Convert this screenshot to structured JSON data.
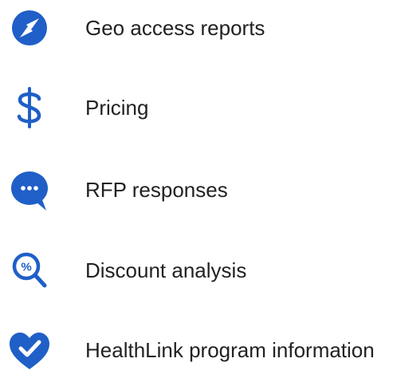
{
  "icon_color": "#1f5fc7",
  "items": [
    {
      "icon": "compass-icon",
      "label": "Geo access reports"
    },
    {
      "icon": "dollar-icon",
      "label": "Pricing"
    },
    {
      "icon": "chat-bubble-icon",
      "label": "RFP responses"
    },
    {
      "icon": "percent-magnifier-icon",
      "label": "Discount analysis"
    },
    {
      "icon": "heart-check-icon",
      "label": "HealthLink program information"
    }
  ]
}
